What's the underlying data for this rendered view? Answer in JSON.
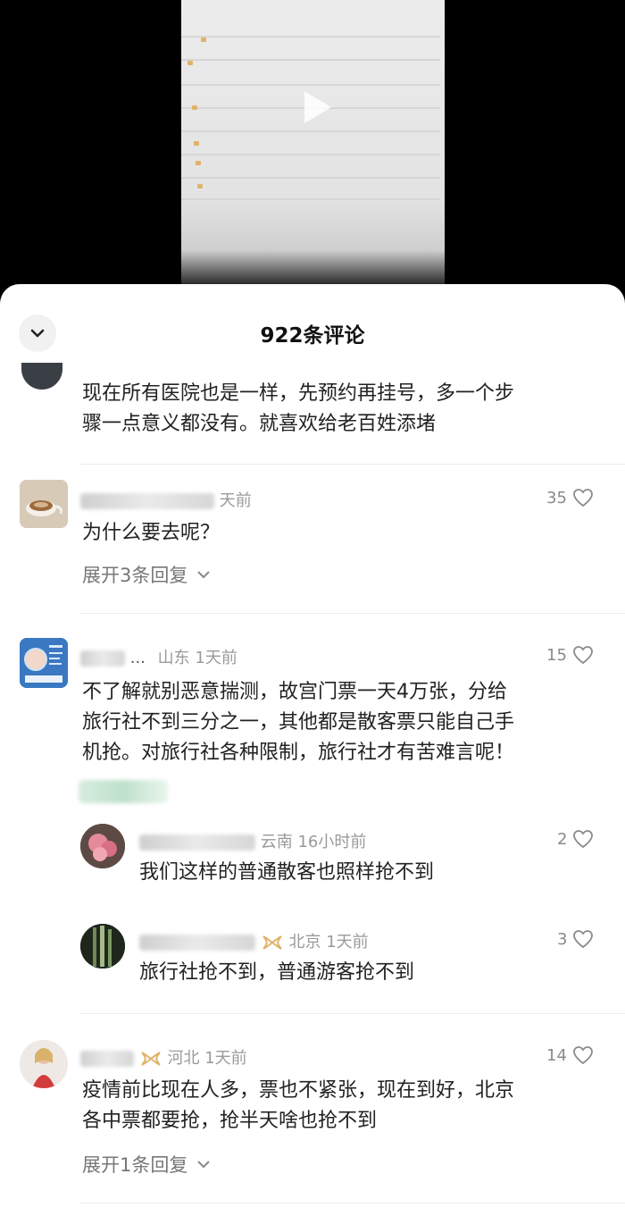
{
  "header": {
    "title": "922条评论"
  },
  "colors": {
    "accent_gold": "#e0b36a",
    "meta_gray": "#9a9a9a"
  },
  "comments": [
    {
      "text_line1": "现在所有医院也是一样，先预约再挂号，多一个步",
      "text_line2": "骤一点意义都没有。就喜欢给老百姓添堵"
    },
    {
      "meta_tail": "天前",
      "likes": "35",
      "text": "为什么要去呢？",
      "expand": "展开3条回复"
    },
    {
      "meta_partial": "...",
      "meta_loc": "山东",
      "meta_time": "1天前",
      "likes": "15",
      "text_line1": "不了解就别恶意揣测，故宫门票一天4万张，分给",
      "text_line2": "旅行社不到三分之一，其他都是散客票只能自己手",
      "text_line3": "机抢。对旅行社各种限制，旅行社才有苦难言呢！",
      "replies": [
        {
          "meta_loc": "云南",
          "meta_time": "16小时前",
          "likes": "2",
          "text": "我们这样的普通散客也照样抢不到"
        },
        {
          "meta_loc": "北京",
          "meta_time": "1天前",
          "likes": "3",
          "text": "旅行社抢不到，普通游客抢不到"
        }
      ]
    },
    {
      "meta_loc": "河北",
      "meta_time": "1天前",
      "likes": "14",
      "text_line1": "疫情前比现在人多，票也不紧张，现在到好，北京",
      "text_line2": "各中票都要抢，抢半天啥也抢不到",
      "expand": "展开1条回复"
    }
  ]
}
